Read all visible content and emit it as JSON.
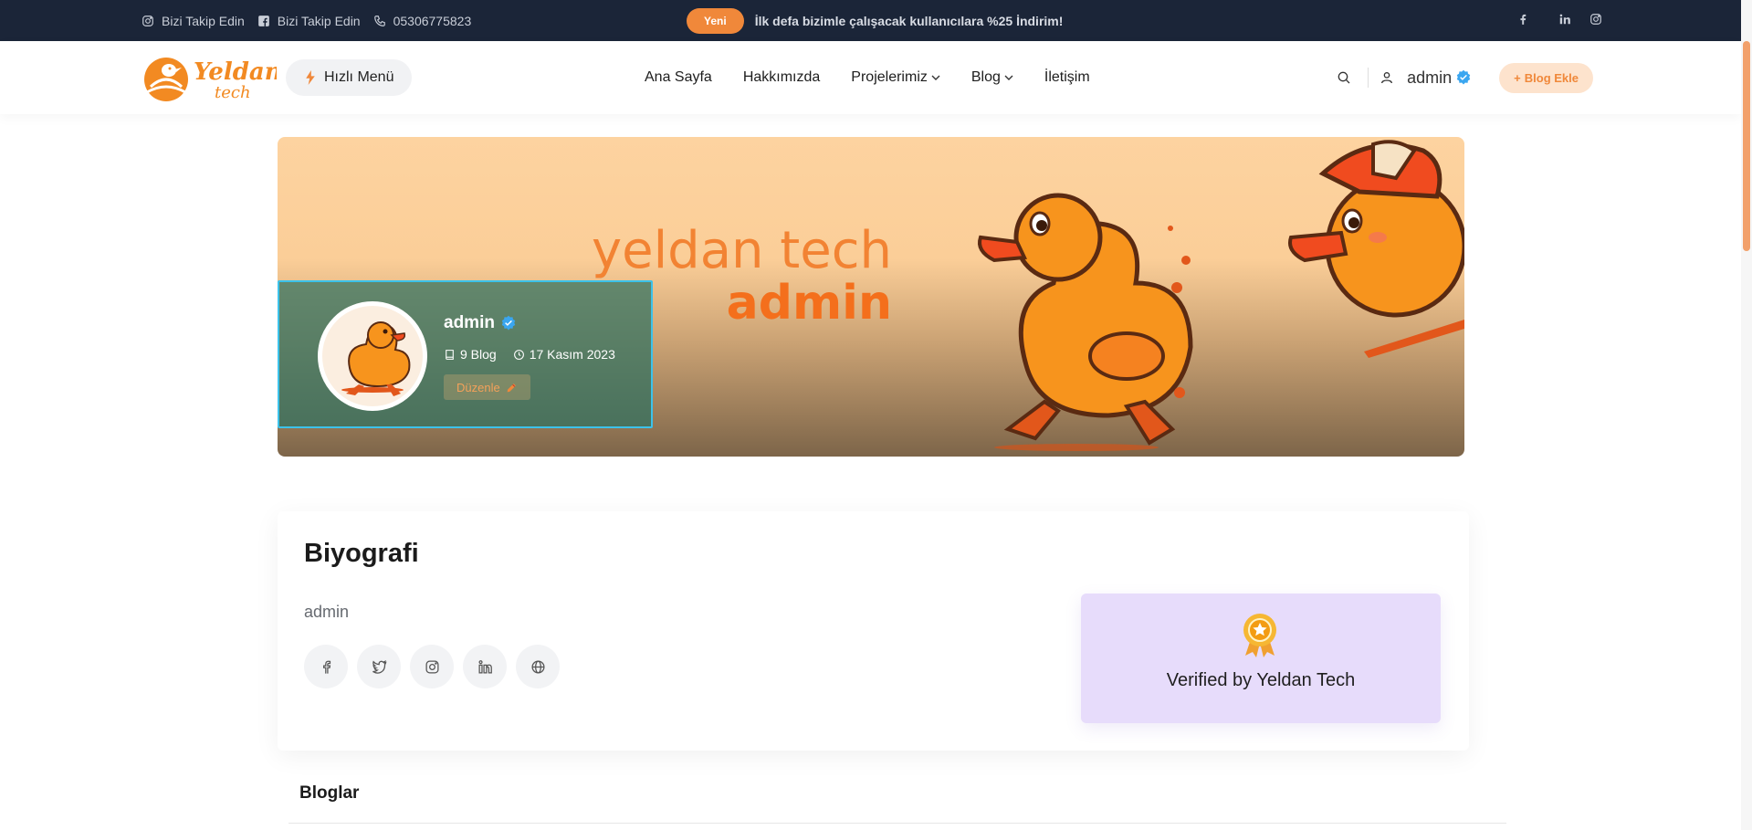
{
  "topbar": {
    "instagram_label": "Bizi Takip Edin",
    "facebook_label": "Bizi Takip Edin",
    "phone": "05306775823",
    "new_badge": "Yeni",
    "promo": "İlk defa bizimle çalışacak kullanıcılara %25 İndirim!",
    "socials": [
      "facebook-icon",
      "linkedin-icon",
      "instagram-icon"
    ],
    "bg_color": "#1b2538"
  },
  "header": {
    "logo_alt": "Yeldan tech",
    "quick_menu": "Hızlı Menü",
    "nav": [
      {
        "label": "Ana Sayfa"
      },
      {
        "label": "Hakkımızda"
      },
      {
        "label": "Projelerimiz",
        "dropdown": true
      },
      {
        "label": "Blog",
        "dropdown": true
      },
      {
        "label": "İletişim"
      }
    ],
    "username": "admin",
    "blog_add": "Blog Ekle",
    "accent_color": "#f0883a"
  },
  "banner": {
    "line1": "yeldan tech",
    "line2": "admin"
  },
  "profile": {
    "name": "admin",
    "blog_count": "9 Blog",
    "joined": "17 Kasım 2023",
    "edit_label": "Düzenle"
  },
  "bio": {
    "title": "Biyografi",
    "text": "admin",
    "socials": [
      "facebook-icon",
      "twitter-icon",
      "instagram-icon",
      "linkedin-icon",
      "globe-icon"
    ],
    "verified_text": "Verified by Yeldan Tech"
  },
  "blogs": {
    "title": "Bloglar"
  }
}
